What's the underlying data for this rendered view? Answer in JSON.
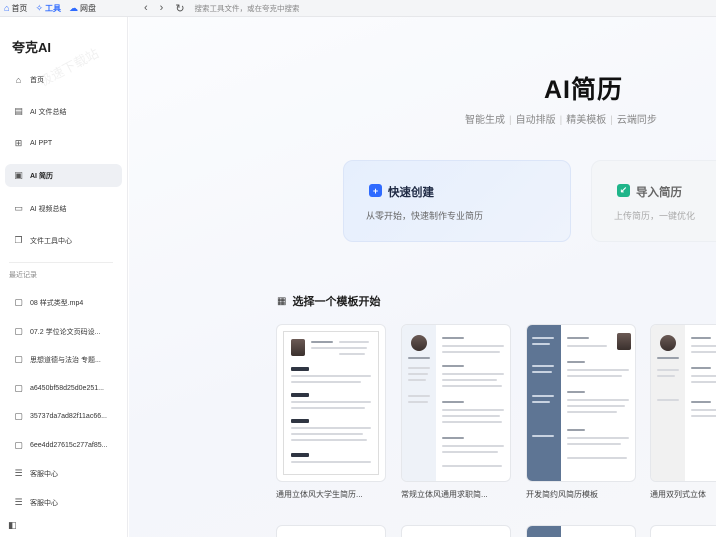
{
  "topbar": {
    "tabs": [
      {
        "label": "首页",
        "icon": "home-icon"
      },
      {
        "label": "工具",
        "icon": "sparkle-icon",
        "active": true
      },
      {
        "label": "网盘",
        "icon": "cloud-icon"
      }
    ],
    "address_placeholder": "搜索工具文件，或在夸克中搜索"
  },
  "sidebar": {
    "brand": "夸克AI",
    "watermark": "极速下载站",
    "items": [
      {
        "label": "首页",
        "icon": "home-icon"
      },
      {
        "label": "AI 文件总结",
        "icon": "doc-summary-icon"
      },
      {
        "label": "AI PPT",
        "icon": "ppt-icon"
      },
      {
        "label": "AI 简历",
        "icon": "resume-icon",
        "active": true
      },
      {
        "label": "AI 视频总结",
        "icon": "video-summary-icon"
      },
      {
        "label": "文件工具中心",
        "icon": "file-tools-icon"
      }
    ],
    "recent_label": "最近记录",
    "recent": [
      "08 样式类型.mp4",
      "07.2 学位论文页码设...",
      "思想道德与法治 专题...",
      "a6450bf58d25d0e251...",
      "35737da7ad82f11ac66...",
      "6ee4dd27615c277af85..."
    ],
    "service": [
      "客服中心",
      "客服中心"
    ]
  },
  "main": {
    "title": "AI简历",
    "features": [
      "智能生成",
      "自动排版",
      "精美模板",
      "云端同步"
    ],
    "quick_card": {
      "title": "快速创建",
      "desc": "从零开始，快速制作专业简历"
    },
    "import_card": {
      "title": "导入简历",
      "desc": "上传简历，一键优化"
    },
    "templates_heading": "选择一个模板开始",
    "templates": [
      {
        "label": "通用立体风大学生简历..."
      },
      {
        "label": "常规立体风通用求职简..."
      },
      {
        "label": "开发简约风简历模板"
      },
      {
        "label": "通用双列式立体"
      }
    ]
  },
  "colors": {
    "accent": "#2f6bff",
    "import_accent": "#1fb58a",
    "template_sidebar": "#5e7594"
  }
}
